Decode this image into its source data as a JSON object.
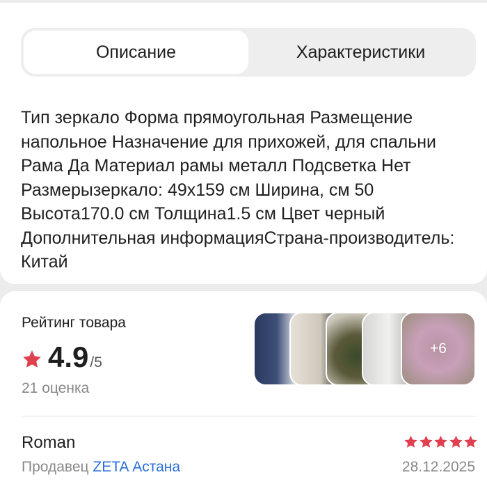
{
  "tabs": [
    {
      "label": "Описание",
      "active": true
    },
    {
      "label": "Характеристики",
      "active": false
    }
  ],
  "description": "Тип зеркало Форма прямоугольная Размещение напольное Назначение для прихожей, для спальни Рама Да Материал рамы металл Подсветка Нет Размерызеркало: 49x159 см Ширина, см 50 Высота170.0 см Толщина1.5 см Цвет черный Дополнительная информацияСтрана-производитель: Китай",
  "rating": {
    "label": "Рейтинг товара",
    "value": "4.9",
    "max": "/5",
    "count": "21 оценка",
    "star_color": "#e04050"
  },
  "photos": {
    "more_count": "+6"
  },
  "review": {
    "author": "Roman",
    "stars": 5,
    "seller_prefix": "Продавец",
    "seller_name": "ZETA Астана",
    "date": "28.12.2025",
    "star_color": "#e04050",
    "link_color": "#2a6fdb"
  }
}
